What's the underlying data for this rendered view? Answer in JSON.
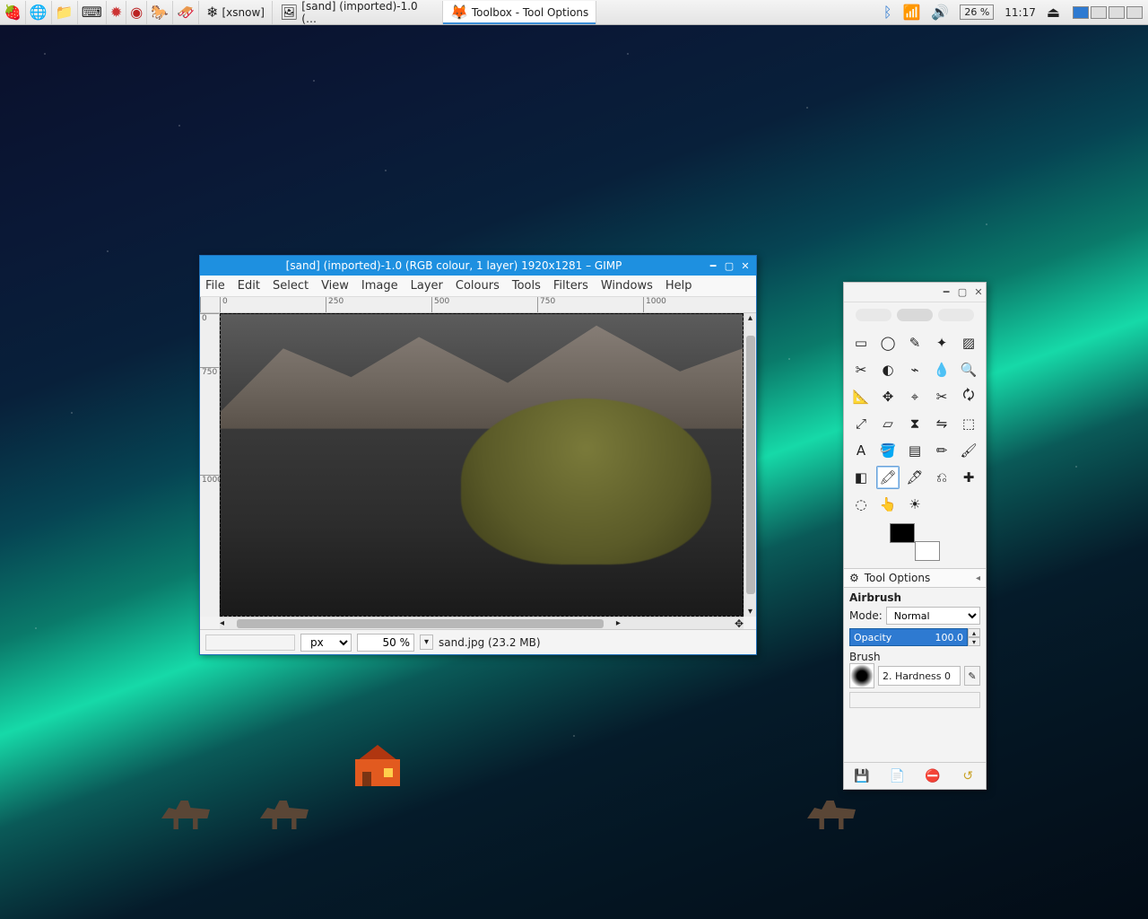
{
  "taskbar": {
    "apps": [
      {
        "label": "[xsnow]"
      },
      {
        "label": "[sand] (imported)-1.0 (…"
      },
      {
        "label": "Toolbox - Tool Options"
      }
    ],
    "battery": "26 %",
    "clock": "11:17"
  },
  "gimp_image": {
    "title": "[sand] (imported)-1.0 (RGB colour, 1 layer) 1920x1281 – GIMP",
    "menus": [
      "File",
      "Edit",
      "Select",
      "View",
      "Image",
      "Layer",
      "Colours",
      "Tools",
      "Filters",
      "Windows",
      "Help"
    ],
    "ruler_h": [
      "0",
      "250",
      "500",
      "750",
      "1000"
    ],
    "ruler_v": [
      "0",
      "750",
      "1000"
    ],
    "status": {
      "unit": "px",
      "zoom": "50 %",
      "file": "sand.jpg (23.2 MB)"
    }
  },
  "toolbox": {
    "options_header": "Tool Options",
    "tool_name": "Airbrush",
    "mode_label": "Mode:",
    "mode_value": "Normal",
    "opacity_label": "Opacity",
    "opacity_value": "100.0",
    "brush_label": "Brush",
    "brush_value": "2. Hardness 0",
    "tools": [
      "rect-select",
      "ellipse-select",
      "free-select",
      "fuzzy-select",
      "by-color-select",
      "scissors",
      "foreground-select",
      "paths",
      "color-picker",
      "zoom",
      "measure",
      "move",
      "align",
      "crop",
      "rotate",
      "scale",
      "shear",
      "perspective",
      "flip",
      "cage",
      "text",
      "bucket-fill",
      "gradient",
      "pencil",
      "paintbrush",
      "eraser",
      "airbrush",
      "ink",
      "clone",
      "heal",
      "blur",
      "smudge",
      "dodge"
    ],
    "selected_tool": "airbrush",
    "tool_glyphs": [
      "▭",
      "◯",
      "✎",
      "✦",
      "▨",
      "✂",
      "◐",
      "⌁",
      "💧",
      "🔍",
      "📐",
      "✥",
      "⌖",
      "✂",
      "🗘",
      "⤢",
      "▱",
      "⧗",
      "⇋",
      "⬚",
      "A",
      "🪣",
      "▤",
      "✏",
      "🖌",
      "◧",
      "🖍",
      "🖋",
      "⎌",
      "✚",
      "◌",
      "👆",
      "☀"
    ]
  }
}
